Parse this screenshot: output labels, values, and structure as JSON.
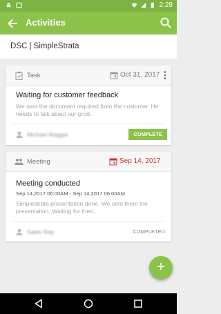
{
  "status_bar": {
    "time": "2:29",
    "icons": [
      "android-icon",
      "screenshot-icon",
      "wifi-icon",
      "signal-icon",
      "battery-icon"
    ]
  },
  "app_bar": {
    "title": "Activities",
    "back_icon": "arrow-back-icon",
    "search_icon": "search-icon"
  },
  "account": {
    "name": "DSC | SimpleStrata"
  },
  "activities": [
    {
      "type": "Task",
      "date": "Oct 31, 2017",
      "title": "Waiting for customer feedback",
      "description": "We sent the document required from the customer. He needs to talk about our prod..",
      "assignee": "Michael Maggie",
      "action_label": "COMPLETE"
    },
    {
      "type": "Meeting",
      "date": "Sep 14, 2017",
      "title": "Meeting conducted",
      "time_range": "Sep 14,2017 06:00AM - Sep 14,2017 06:00AM",
      "description": "Simplestrata presentation done. We sent them the presentation. Waiting for their..",
      "assignee": "Sales Rep",
      "status_label": "COMPLETED"
    }
  ],
  "fab": {
    "label": "+"
  },
  "colors": {
    "primary": "#8bc34a",
    "primary_dark": "#7cb342",
    "overdue": "#d32f2f"
  }
}
